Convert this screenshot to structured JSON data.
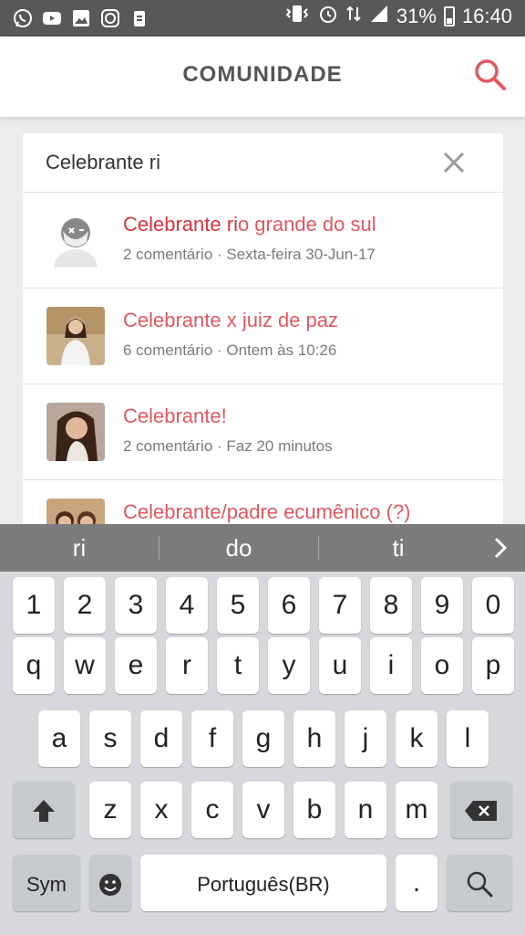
{
  "status_bar": {
    "left_icons": [
      "whatsapp-icon",
      "youtube-icon",
      "gallery-icon",
      "clock-app-icon",
      "cleaner-icon"
    ],
    "battery": "31%",
    "time": "16:40"
  },
  "header": {
    "title": "COMUNIDADE"
  },
  "search": {
    "value": "Celebrante ri"
  },
  "results": [
    {
      "title_match": "Celebrante ri",
      "title_rest": "o grande do sul",
      "meta": "2 comentário · Sexta-feira 30-Jun-17",
      "avatar": "default-avatar"
    },
    {
      "title_match": "",
      "title_rest": "Celebrante x juiz de paz",
      "meta": "6 comentário · Ontem às 10:26",
      "avatar": "photo"
    },
    {
      "title_match": "",
      "title_rest": "Celebrante!",
      "meta": "2 comentário · Faz 20 minutos",
      "avatar": "photo"
    },
    {
      "title_match": "",
      "title_rest": "Celebrante/padre ecumênico (?)",
      "meta": "",
      "avatar": "photo"
    }
  ],
  "keyboard": {
    "suggestions": [
      "ri",
      "do",
      "ti"
    ],
    "row_numbers": [
      "1",
      "2",
      "3",
      "4",
      "5",
      "6",
      "7",
      "8",
      "9",
      "0"
    ],
    "row1": [
      "q",
      "w",
      "e",
      "r",
      "t",
      "y",
      "u",
      "i",
      "o",
      "p"
    ],
    "row2": [
      "a",
      "s",
      "d",
      "f",
      "g",
      "h",
      "j",
      "k",
      "l"
    ],
    "row3": [
      "z",
      "x",
      "c",
      "v",
      "b",
      "n",
      "m"
    ],
    "sym_label": "Sym",
    "space_label": "Português(BR)",
    "period_label": "."
  },
  "colors": {
    "accent": "#e0585f",
    "status_bar": "#585858",
    "suggest_bar": "#7c7c7c"
  }
}
